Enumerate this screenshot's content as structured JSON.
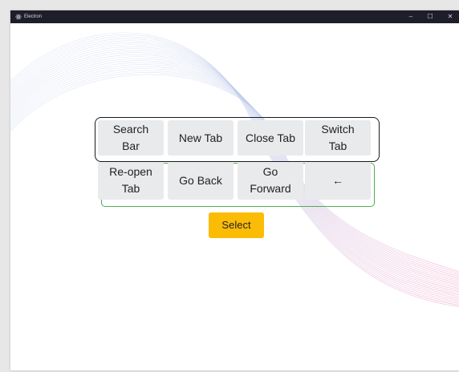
{
  "window": {
    "title": "Electron",
    "controls": {
      "minimize": "–",
      "maximize": "☐",
      "close": "✕"
    }
  },
  "keyboard": {
    "row1": [
      "Search\nBar",
      "New Tab",
      "Close Tab",
      "Switch\nTab"
    ],
    "row2": [
      "Re-open\nTab",
      "Go Back",
      "Go\nForward",
      "←"
    ],
    "highlighted_row": 1
  },
  "select_button": {
    "label": "Select"
  },
  "colors": {
    "accent_button": "#fbbc05",
    "row_highlight_border": "#1a1a1a",
    "grid_border": "#4caf50",
    "key_background": "#e9eaec",
    "titlebar": "#1e1e2a"
  }
}
